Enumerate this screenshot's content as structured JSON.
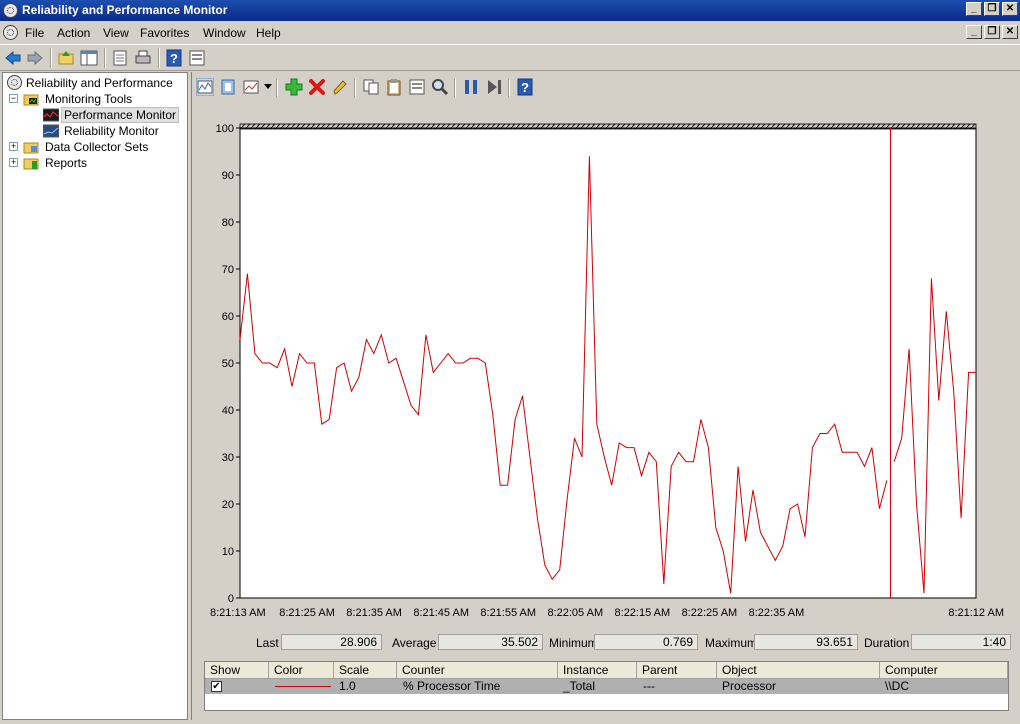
{
  "window": {
    "title": "Reliability and Performance Monitor",
    "controls": {
      "minimize": "_",
      "restore": "❐",
      "close": "✕"
    }
  },
  "menu": {
    "items": [
      {
        "label": "File"
      },
      {
        "label": "Action"
      },
      {
        "label": "View"
      },
      {
        "label": "Favorites"
      },
      {
        "label": "Window"
      },
      {
        "label": "Help"
      }
    ]
  },
  "tree": {
    "root": "Reliability and Performance",
    "monitoring_tools": "Monitoring Tools",
    "performance_monitor": "Performance Monitor",
    "reliability_monitor": "Reliability Monitor",
    "data_collector_sets": "Data Collector Sets",
    "reports": "Reports",
    "expanded_sign": "−",
    "collapsed_sign": "+"
  },
  "chart_data": {
    "type": "line",
    "yticks": [
      "100",
      "90",
      "80",
      "70",
      "60",
      "50",
      "40",
      "30",
      "20",
      "10",
      "0"
    ],
    "xticks": [
      "8:21:13 AM",
      "8:21:25 AM",
      "8:21:35 AM",
      "8:21:45 AM",
      "8:21:55 AM",
      "8:22:05 AM",
      "8:22:15 AM",
      "8:22:25 AM",
      "8:22:35 AM",
      "8:21:12 AM"
    ],
    "ylim": [
      0,
      100
    ],
    "samples": 100,
    "current_sample": 88,
    "series": [
      {
        "color": "#d00000",
        "values": [
          55,
          69,
          52,
          50,
          50,
          49,
          53,
          45,
          52,
          50,
          50,
          37,
          38,
          49,
          50,
          44,
          47,
          55,
          52,
          56,
          50,
          51,
          46,
          41,
          39,
          56,
          48,
          50,
          52,
          50,
          50,
          51,
          51,
          50,
          39,
          24,
          24,
          38,
          43,
          30,
          17,
          7,
          4,
          6,
          21,
          34,
          30,
          94,
          37,
          30,
          24,
          33,
          32,
          32,
          26,
          31,
          29,
          3,
          28,
          31,
          29,
          29,
          38,
          32,
          15,
          10,
          1,
          28,
          12,
          23,
          14,
          11,
          8,
          11,
          19,
          20,
          13,
          32,
          35,
          35,
          37,
          31,
          31,
          31,
          28,
          32,
          19,
          25,
          29,
          34,
          53,
          20,
          1,
          68,
          42,
          61,
          44,
          17,
          48,
          48
        ]
      }
    ]
  },
  "stats": {
    "last_label": "Last",
    "last_value": "28.906",
    "average_label": "Average",
    "average_value": "35.502",
    "minimum_label": "Minimum",
    "minimum_value": "0.769",
    "maximum_label": "Maximum",
    "maximum_value": "93.651",
    "duration_label": "Duration",
    "duration_value": "1:40"
  },
  "counters": {
    "headers": {
      "show": "Show",
      "color": "Color",
      "scale": "Scale",
      "counter": "Counter",
      "instance": "Instance",
      "parent": "Parent",
      "object": "Object",
      "computer": "Computer"
    },
    "rows": [
      {
        "checked": "✔",
        "color": "#d00000",
        "scale": "1.0",
        "counter": "% Processor Time",
        "instance": "_Total",
        "parent": "---",
        "object": "Processor",
        "computer": "\\\\DC"
      }
    ]
  }
}
